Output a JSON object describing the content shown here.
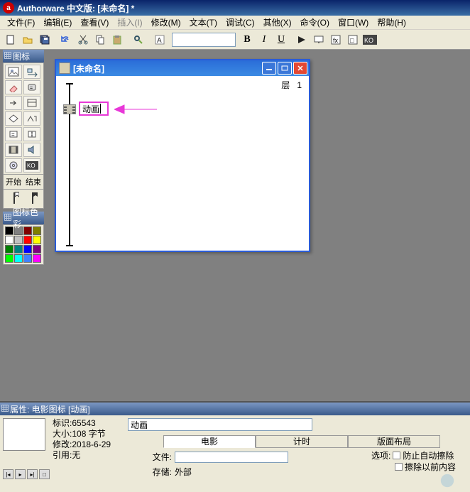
{
  "title": "Authorware 中文版: [未命名] *",
  "menu": {
    "file": "文件(F)",
    "edit": "编辑(E)",
    "view": "查看(V)",
    "insert": "插入(I)",
    "modify": "修改(M)",
    "text": "文本(T)",
    "debug": "调试(C)",
    "other": "其他(X)",
    "cmd": "命令(O)",
    "window": "窗口(W)",
    "help": "帮助(H)"
  },
  "palette": {
    "title": "图标",
    "start": "开始",
    "end": "结束",
    "colors_title": "图标色彩"
  },
  "doc": {
    "title": "[未命名]",
    "layer_label": "层",
    "layer_num": "1",
    "icon_name": "动画"
  },
  "props": {
    "title": "属性: 电影图标 [动画]",
    "info": {
      "id_label": "标识:",
      "id": "65543",
      "size_label": "大小:",
      "size": "108 字节",
      "mod_label": "修改:",
      "mod": "2018-6-29",
      "ref_label": "引用:",
      "ref": "无"
    },
    "name_value": "动画",
    "tabs": {
      "movie": "电影",
      "timing": "计时",
      "layout": "版面布局"
    },
    "fields": {
      "file_label": "文件:",
      "storage_label": "存储:",
      "storage_value": "外部"
    },
    "options": {
      "label": "选项:",
      "opt1": "防止自动擦除",
      "opt2": "擦除以前内容"
    }
  },
  "colors": [
    "#000000",
    "#808080",
    "#800000",
    "#808000",
    "#ffffff",
    "#c0c0c0",
    "#ff0000",
    "#ffff00",
    "#008000",
    "#008080",
    "#0000ff",
    "#800080",
    "#00ff00",
    "#00ffff",
    "#4080ff",
    "#ff00ff"
  ]
}
